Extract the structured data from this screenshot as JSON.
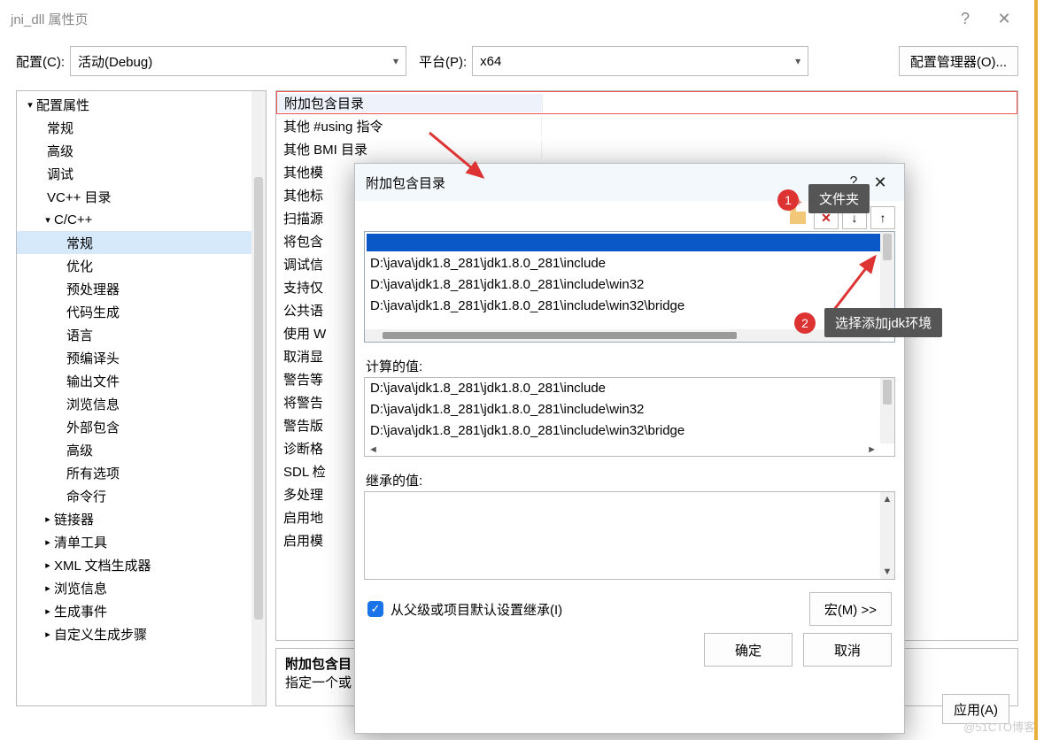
{
  "window": {
    "title": "jni_dll 属性页",
    "help": "?",
    "close": "✕"
  },
  "config": {
    "label": "配置(C):",
    "value": "活动(Debug)",
    "platform_label": "平台(P):",
    "platform_value": "x64",
    "manager_btn": "配置管理器(O)..."
  },
  "tree": {
    "items": [
      {
        "text": "配置属性",
        "type": "group",
        "open": true
      },
      {
        "text": "常规",
        "type": "child1"
      },
      {
        "text": "高级",
        "type": "child1"
      },
      {
        "text": "调试",
        "type": "child1"
      },
      {
        "text": "VC++ 目录",
        "type": "child1"
      },
      {
        "text": "C/C++",
        "type": "group1",
        "open": true
      },
      {
        "text": "常规",
        "type": "child2",
        "sel": true
      },
      {
        "text": "优化",
        "type": "child2"
      },
      {
        "text": "预处理器",
        "type": "child2"
      },
      {
        "text": "代码生成",
        "type": "child2"
      },
      {
        "text": "语言",
        "type": "child2"
      },
      {
        "text": "预编译头",
        "type": "child2"
      },
      {
        "text": "输出文件",
        "type": "child2"
      },
      {
        "text": "浏览信息",
        "type": "child2"
      },
      {
        "text": "外部包含",
        "type": "child2"
      },
      {
        "text": "高级",
        "type": "child2"
      },
      {
        "text": "所有选项",
        "type": "child2"
      },
      {
        "text": "命令行",
        "type": "child2"
      },
      {
        "text": "链接器",
        "type": "group1c"
      },
      {
        "text": "清单工具",
        "type": "group1c"
      },
      {
        "text": "XML 文档生成器",
        "type": "group1c"
      },
      {
        "text": "浏览信息",
        "type": "group1c"
      },
      {
        "text": "生成事件",
        "type": "group1c"
      },
      {
        "text": "自定义生成步骤",
        "type": "group1c"
      }
    ]
  },
  "props": [
    "附加包含目录",
    "其他 #using 指令",
    "其他 BMI 目录",
    "其他模",
    "其他标",
    "扫描源",
    "将包含",
    "调试信",
    "支持仅",
    "公共语",
    "使用 W",
    "取消显",
    "警告等",
    "将警告",
    "警告版",
    "诊断格",
    "SDL 检",
    "多处理",
    "启用地",
    "启用模"
  ],
  "desc": {
    "title": "附加包含目",
    "body": "指定一个或"
  },
  "footer": {
    "apply": "应用(A)"
  },
  "modal": {
    "title": "附加包含目录",
    "paths": [
      "D:\\java\\jdk1.8_281\\jdk1.8.0_281\\include",
      "D:\\java\\jdk1.8_281\\jdk1.8.0_281\\include\\win32",
      "D:\\java\\jdk1.8_281\\jdk1.8.0_281\\include\\win32\\bridge"
    ],
    "calc_label": "计算的值:",
    "calc": [
      "D:\\java\\jdk1.8_281\\jdk1.8.0_281\\include",
      "D:\\java\\jdk1.8_281\\jdk1.8.0_281\\include\\win32",
      "D:\\java\\jdk1.8_281\\jdk1.8.0_281\\include\\win32\\bridge"
    ],
    "inherit_label": "继承的值:",
    "checkbox": "从父级或项目默认设置继承(I)",
    "macro_btn": "宏(M) >>",
    "ok": "确定",
    "cancel": "取消"
  },
  "annotations": {
    "tip1": "文件夹",
    "tip2": "选择添加jdk环境",
    "badge1": "1",
    "badge2": "2"
  },
  "watermark": "@51CTO博客"
}
